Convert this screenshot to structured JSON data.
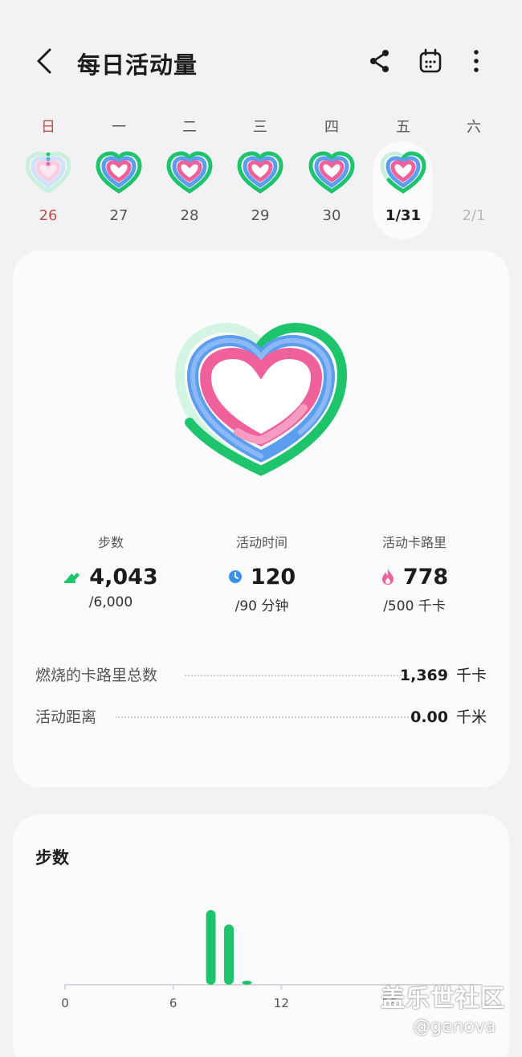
{
  "header": {
    "title": "每日活动量"
  },
  "week": [
    {
      "weekday": "日",
      "date": "26"
    },
    {
      "weekday": "一",
      "date": "27"
    },
    {
      "weekday": "二",
      "date": "28"
    },
    {
      "weekday": "三",
      "date": "29"
    },
    {
      "weekday": "四",
      "date": "30"
    },
    {
      "weekday": "五",
      "date": "1/31"
    },
    {
      "weekday": "六",
      "date": "2/1"
    }
  ],
  "stats": {
    "steps": {
      "label": "步数",
      "value": "4,043",
      "goal": "/6,000"
    },
    "active_time": {
      "label": "活动时间",
      "value": "120",
      "goal": "/90 分钟"
    },
    "active_calories": {
      "label": "活动卡路里",
      "value": "778",
      "goal": "/500 千卡"
    }
  },
  "details": {
    "total_calories": {
      "label": "燃烧的卡路里总数",
      "value": "1,369",
      "unit": "千卡"
    },
    "distance": {
      "label": "活动距离",
      "value": "0.00",
      "unit": "千米"
    }
  },
  "steps_card": {
    "title": "步数"
  },
  "chart_data": {
    "type": "bar",
    "title": "步数",
    "x_ticks": [
      "0",
      "6",
      "12",
      "18"
    ],
    "bars": [
      {
        "hour": 8,
        "rel_height": 0.93
      },
      {
        "hour": 9,
        "rel_height": 0.75
      },
      {
        "hour": 10,
        "rel_height": 0.05
      }
    ]
  },
  "colors": {
    "green": "#1ec46b",
    "blue": "#5b9ef0",
    "pink": "#f0609a",
    "sunday": "#c0514a"
  },
  "watermark": {
    "line1": "盖乐世社区",
    "line2": "@genova"
  }
}
